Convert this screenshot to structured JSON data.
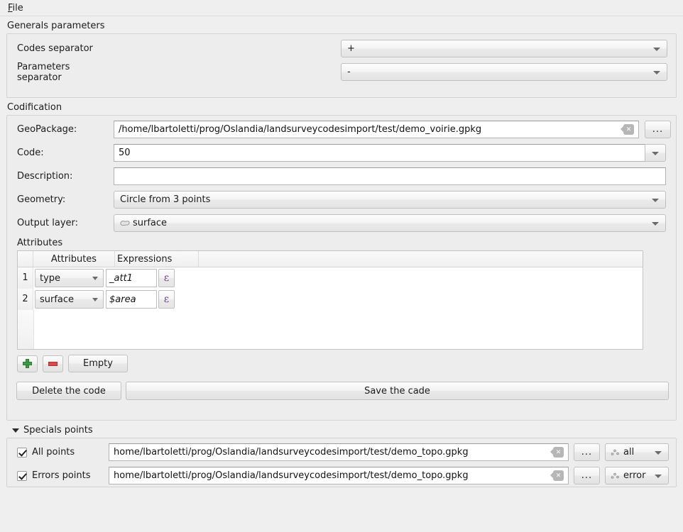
{
  "menubar": {
    "file": "File",
    "file_mnemonic": "F",
    "file_rest": "ile"
  },
  "generals": {
    "title": "Generals parameters",
    "rows": [
      {
        "label": "Codes separator",
        "value": "+"
      },
      {
        "label": "Parameters separator",
        "value": "-"
      }
    ]
  },
  "codification": {
    "title": "Codification",
    "geopackage": {
      "label": "GeoPackage:",
      "value": "/home/lbartoletti/prog/Oslandia/landsurveycodesimport/test/demo_voirie.gpkg",
      "clear_glyph": "✕",
      "browse_label": "..."
    },
    "code": {
      "label": "Code:",
      "value": "50"
    },
    "description": {
      "label": "Description:",
      "value": "",
      "placeholder": ""
    },
    "geometry": {
      "label": "Geometry:",
      "value": "Circle from 3 points"
    },
    "output_layer": {
      "label": "Output layer:",
      "value": "surface",
      "icon": "polygon-layer-icon"
    },
    "attributes": {
      "title": "Attributes",
      "headers": {
        "corner": "",
        "attributes": "Attributes",
        "expressions": "Expressions"
      },
      "rows": [
        {
          "num": "1",
          "attribute": "type",
          "expression": "_att1",
          "expr_btn": "ε"
        },
        {
          "num": "2",
          "attribute": "surface",
          "expression": "$area",
          "expr_btn": "ε"
        }
      ],
      "toolbar": {
        "add_icon": "plus-icon",
        "remove_icon": "minus-icon",
        "empty_label": "Empty"
      }
    },
    "delete_button": "Delete the code",
    "save_button": "Save the cade"
  },
  "specials_points": {
    "title": "Specials points",
    "collapsed": false,
    "rows": [
      {
        "checked": true,
        "label": "All points",
        "path": "home/lbartoletti/prog/Oslandia/landsurveycodesimport/test/demo_topo.gpkg",
        "browse_label": "...",
        "layer": "all",
        "layer_icon": "point-layer-icon"
      },
      {
        "checked": true,
        "label": "Errors points",
        "path": "home/lbartoletti/prog/Oslandia/landsurveycodesimport/test/demo_topo.gpkg",
        "browse_label": "...",
        "layer": "error",
        "layer_icon": "point-layer-icon"
      }
    ]
  },
  "colors": {
    "window_bg": "#efefef",
    "group_bg": "#ededed",
    "field_bg": "#ffffff",
    "text": "#1c1c1c",
    "expression_purple": "#6b3f82",
    "add_green": "#3f9b46",
    "remove_red": "#d94b4b"
  }
}
